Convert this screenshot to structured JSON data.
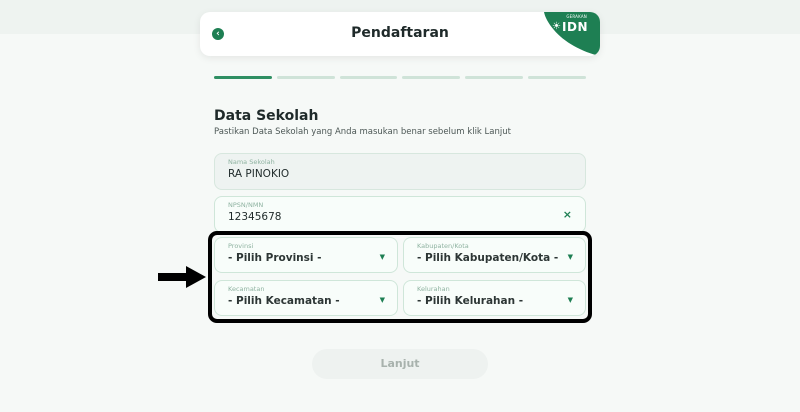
{
  "header": {
    "title": "Pendaftaran",
    "brand_small": "GERAKAN",
    "brand_text": "IDN",
    "brand_color": "#1e7f53"
  },
  "progress": {
    "total_steps": 6,
    "current_step": 1
  },
  "section": {
    "title": "Data Sekolah",
    "subtitle": "Pastikan Data Sekolah yang Anda masukan benar sebelum klik Lanjut"
  },
  "fields": {
    "school_name": {
      "label": "Nama Sekolah",
      "value": "RA PINOKIO"
    },
    "npsn": {
      "label": "NPSN/NMN",
      "value": "12345678",
      "clear_icon": "×"
    },
    "province": {
      "label": "Provinsi",
      "value": "- Pilih Provinsi -"
    },
    "city": {
      "label": "Kabupaten/Kota",
      "value": "- Pilih Kabupaten/Kota -"
    },
    "district": {
      "label": "Kecamatan",
      "value": "- Pilih Kecamatan -"
    },
    "village": {
      "label": "Kelurahan",
      "value": "- Pilih Kelurahan -"
    }
  },
  "icons": {
    "back": "‹",
    "caret": "▼",
    "sun": "☀"
  },
  "submit": {
    "label": "Lanjut"
  },
  "colors": {
    "accent": "#1e7f53",
    "annotation": "#000000"
  }
}
